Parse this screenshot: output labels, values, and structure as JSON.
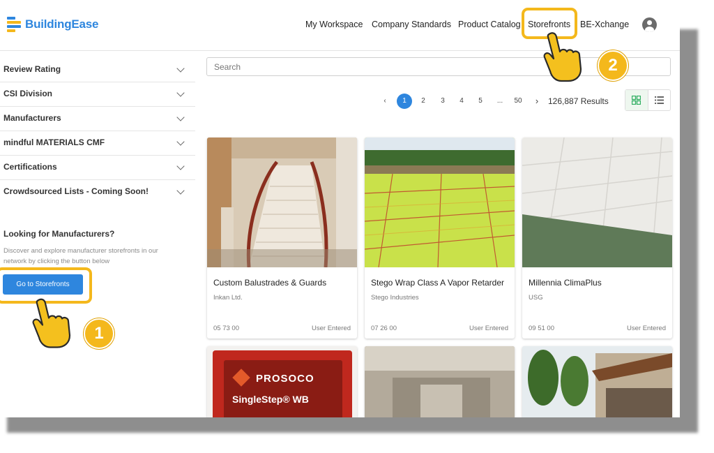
{
  "brand": {
    "name": "BuildingEase",
    "logo_icon": "buildingease-logo-icon"
  },
  "nav": {
    "items": [
      "My Workspace",
      "Company Standards",
      "Product Catalog",
      "Storefronts",
      "BE-Xchange"
    ],
    "profile_icon": "user-circle-icon"
  },
  "sidebar": {
    "filters": [
      "Review Rating",
      "CSI Division",
      "Manufacturers",
      "mindful MATERIALS CMF",
      "Certifications",
      "Crowdsourced Lists - Coming Soon!"
    ],
    "looking_title": "Looking for Manufacturers?",
    "looking_desc": "Discover and explore manufacturer storefronts in our network by clicking the button below",
    "cta_label": "Go to Storefronts"
  },
  "search": {
    "placeholder": "Search"
  },
  "pagination": {
    "pages": [
      "1",
      "2",
      "3",
      "4",
      "5",
      "...",
      "50"
    ],
    "current": "1",
    "results": "126,887 Results"
  },
  "products": [
    {
      "title": "Custom Balustrades & Guards",
      "manufacturer": "Inkan Ltd.",
      "code": "05 73 00",
      "source": "User Entered"
    },
    {
      "title": "Stego Wrap Class A Vapor Retarder",
      "manufacturer": "Stego Industries",
      "code": "07 26 00",
      "source": "User Entered"
    },
    {
      "title": "Millennia ClimaPlus",
      "manufacturer": "USG",
      "code": "09 51 00",
      "source": "User Entered"
    }
  ],
  "second_row": {
    "prosoco_label": "PROSOCO",
    "product_label": "SingleStep® WB"
  },
  "annotations": {
    "step1": "1",
    "step2": "2"
  },
  "colors": {
    "brand_blue": "#2e86de",
    "highlight": "#f4b81c",
    "grid_active": "#2fae61"
  }
}
